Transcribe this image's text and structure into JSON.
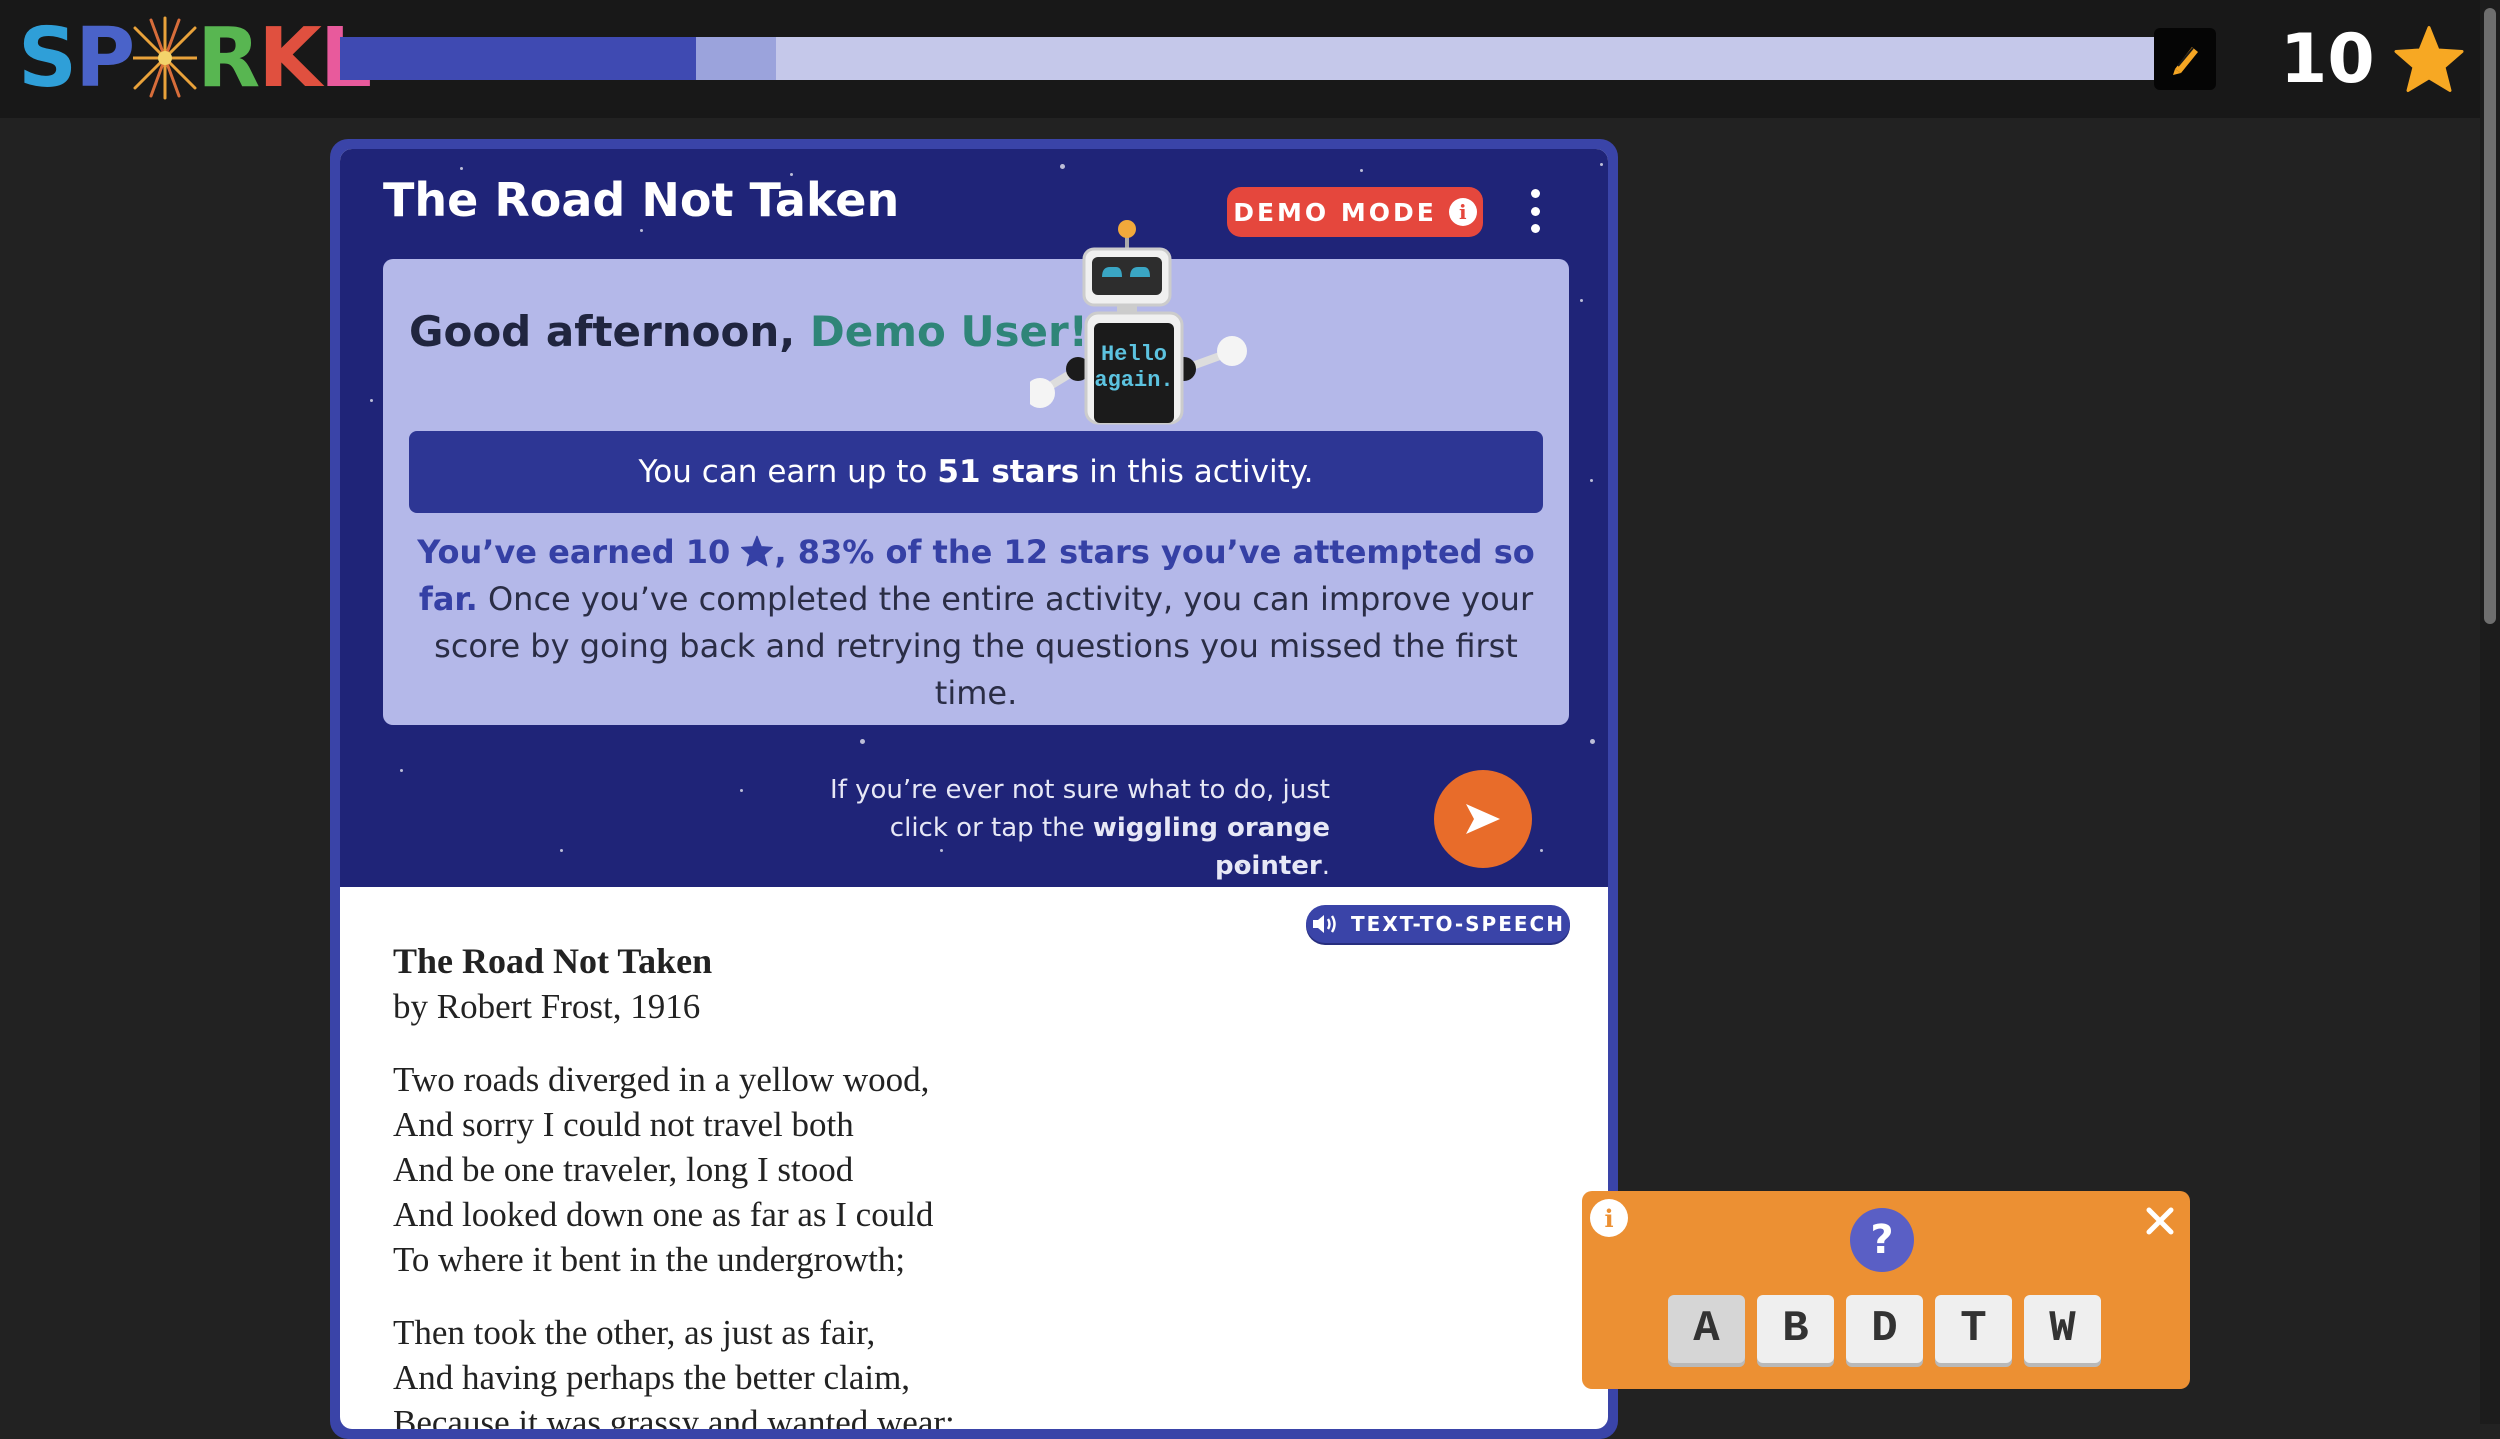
{
  "app": {
    "logo_letters": [
      "S",
      "P",
      "R",
      "K",
      "L"
    ],
    "progress": {
      "completed_fraction": 0.196,
      "attempted_fraction": 0.24
    },
    "score": "10"
  },
  "card": {
    "title": "The Road Not Taken",
    "demo_badge": "DEMO MODE",
    "greeting": {
      "prefix": "Good afternoon, ",
      "name": "Demo User!"
    },
    "robot_screen": [
      "Hello",
      "again."
    ],
    "earn": {
      "before": "You can earn up to",
      "bold": "51 stars",
      "after": "in this activity."
    },
    "earned": {
      "hl_a": "You’ve earned 10",
      "hl_b": ", 83% of the 12 stars you’ve attempted so far.",
      "rest": " Once you’ve completed the entire activity, you can improve your score by going back and retrying the questions you missed the first time."
    },
    "hint": {
      "line1": "If you’re ever not sure what to do, just",
      "line2_before": "click or tap the ",
      "line2_bold": "wiggling orange pointer",
      "line2_after": "."
    }
  },
  "reading": {
    "tts_label": "TEXT-TO-SPEECH",
    "poem_title": "The Road Not Taken",
    "poem_byline": "by Robert Frost, 1916",
    "stanza1": [
      "Two roads diverged in a yellow wood,",
      "And sorry I could not travel both",
      "And be one traveler, long I stood",
      "And looked down one as far as I could",
      "To where it bent in the undergrowth;"
    ],
    "stanza2": [
      "Then took the other, as just as fair,",
      "And having perhaps the better claim,",
      "Because it was grassy and wanted wear;"
    ]
  },
  "widget": {
    "help_symbol": "?",
    "letters": [
      "A",
      "B",
      "D",
      "T",
      "W"
    ]
  },
  "colors": {
    "accent": "#3a44a8",
    "space": "#1f2478",
    "panel": "#b4b8e9",
    "orange": "#e86c2a",
    "star": "#f7a823",
    "demo_red": "#e5473d"
  }
}
